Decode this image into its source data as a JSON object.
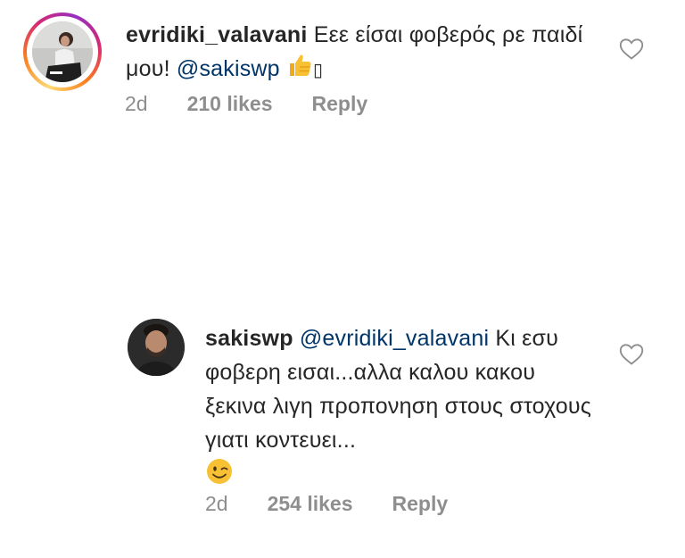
{
  "comments": [
    {
      "username": "evridiki_valavani",
      "text": "Εεε είσαι φοβερός ρε παιδί μου!",
      "mention": "@sakiswp",
      "emoji": "thumbs-up",
      "trailing_glyph": "▯",
      "time": "2d",
      "likes": "210 likes",
      "reply_label": "Reply"
    },
    {
      "username": "sakiswp",
      "mention": "@evridiki_valavani",
      "text": "Κι εσυ φοβερη εισαι...αλλα καλου κακου ξεκινα λιγη προπονηση στους στοχους γιατι κοντευει...",
      "emoji": "winking-face",
      "time": "2d",
      "likes": "254 likes",
      "reply_label": "Reply"
    }
  ],
  "colors": {
    "text": "#262626",
    "meta": "#8e8e8e",
    "mention": "#003569",
    "heart_stroke": "#8e8e8e"
  }
}
